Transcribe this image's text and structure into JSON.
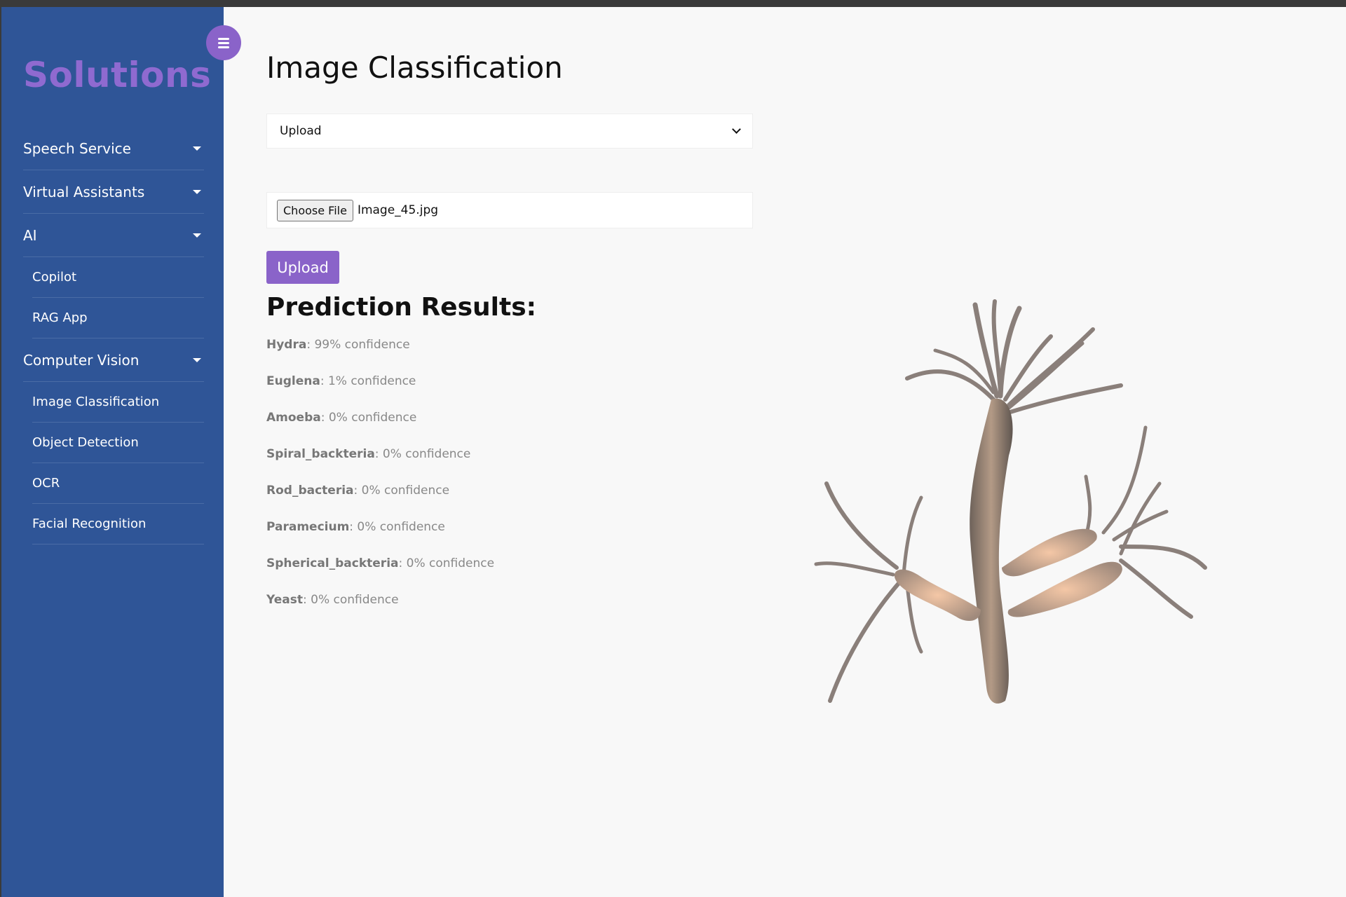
{
  "sidebar": {
    "brand": "Solutions",
    "toggle_icon": "menu-icon",
    "items": [
      {
        "label": "Speech Service",
        "expandable": true
      },
      {
        "label": "Virtual Assistants",
        "expandable": true
      },
      {
        "label": "AI",
        "expandable": true
      },
      {
        "label": "Copilot",
        "expandable": false
      },
      {
        "label": "RAG App",
        "expandable": false
      },
      {
        "label": "Computer Vision",
        "expandable": true
      },
      {
        "label": "Image Classification",
        "expandable": false
      },
      {
        "label": "Object Detection",
        "expandable": false
      },
      {
        "label": "OCR",
        "expandable": false
      },
      {
        "label": "Facial Recognition",
        "expandable": false
      }
    ]
  },
  "main": {
    "title": "Image Classification",
    "source_select": {
      "selected": "Upload"
    },
    "file_input": {
      "button_label": "Choose File",
      "file_name": "Image_45.jpg"
    },
    "upload_button": "Upload",
    "results_title": "Prediction Results:",
    "results": [
      {
        "label": "Hydra",
        "text": ": 99% confidence"
      },
      {
        "label": "Euglena",
        "text": ": 1% confidence"
      },
      {
        "label": "Amoeba",
        "text": ": 0% confidence"
      },
      {
        "label": "Spiral_backteria",
        "text": ": 0% confidence"
      },
      {
        "label": "Rod_bacteria",
        "text": ": 0% confidence"
      },
      {
        "label": "Paramecium",
        "text": ": 0% confidence"
      },
      {
        "label": "Spherical_backteria",
        "text": ": 0% confidence"
      },
      {
        "label": "Yeast",
        "text": ": 0% confidence"
      }
    ],
    "image_subject": "hydra-specimen"
  },
  "colors": {
    "sidebar_bg": "#2f5597",
    "accent": "#8a63c9",
    "brand_text": "#8f6ad0",
    "page_bg": "#f8f8f8"
  }
}
